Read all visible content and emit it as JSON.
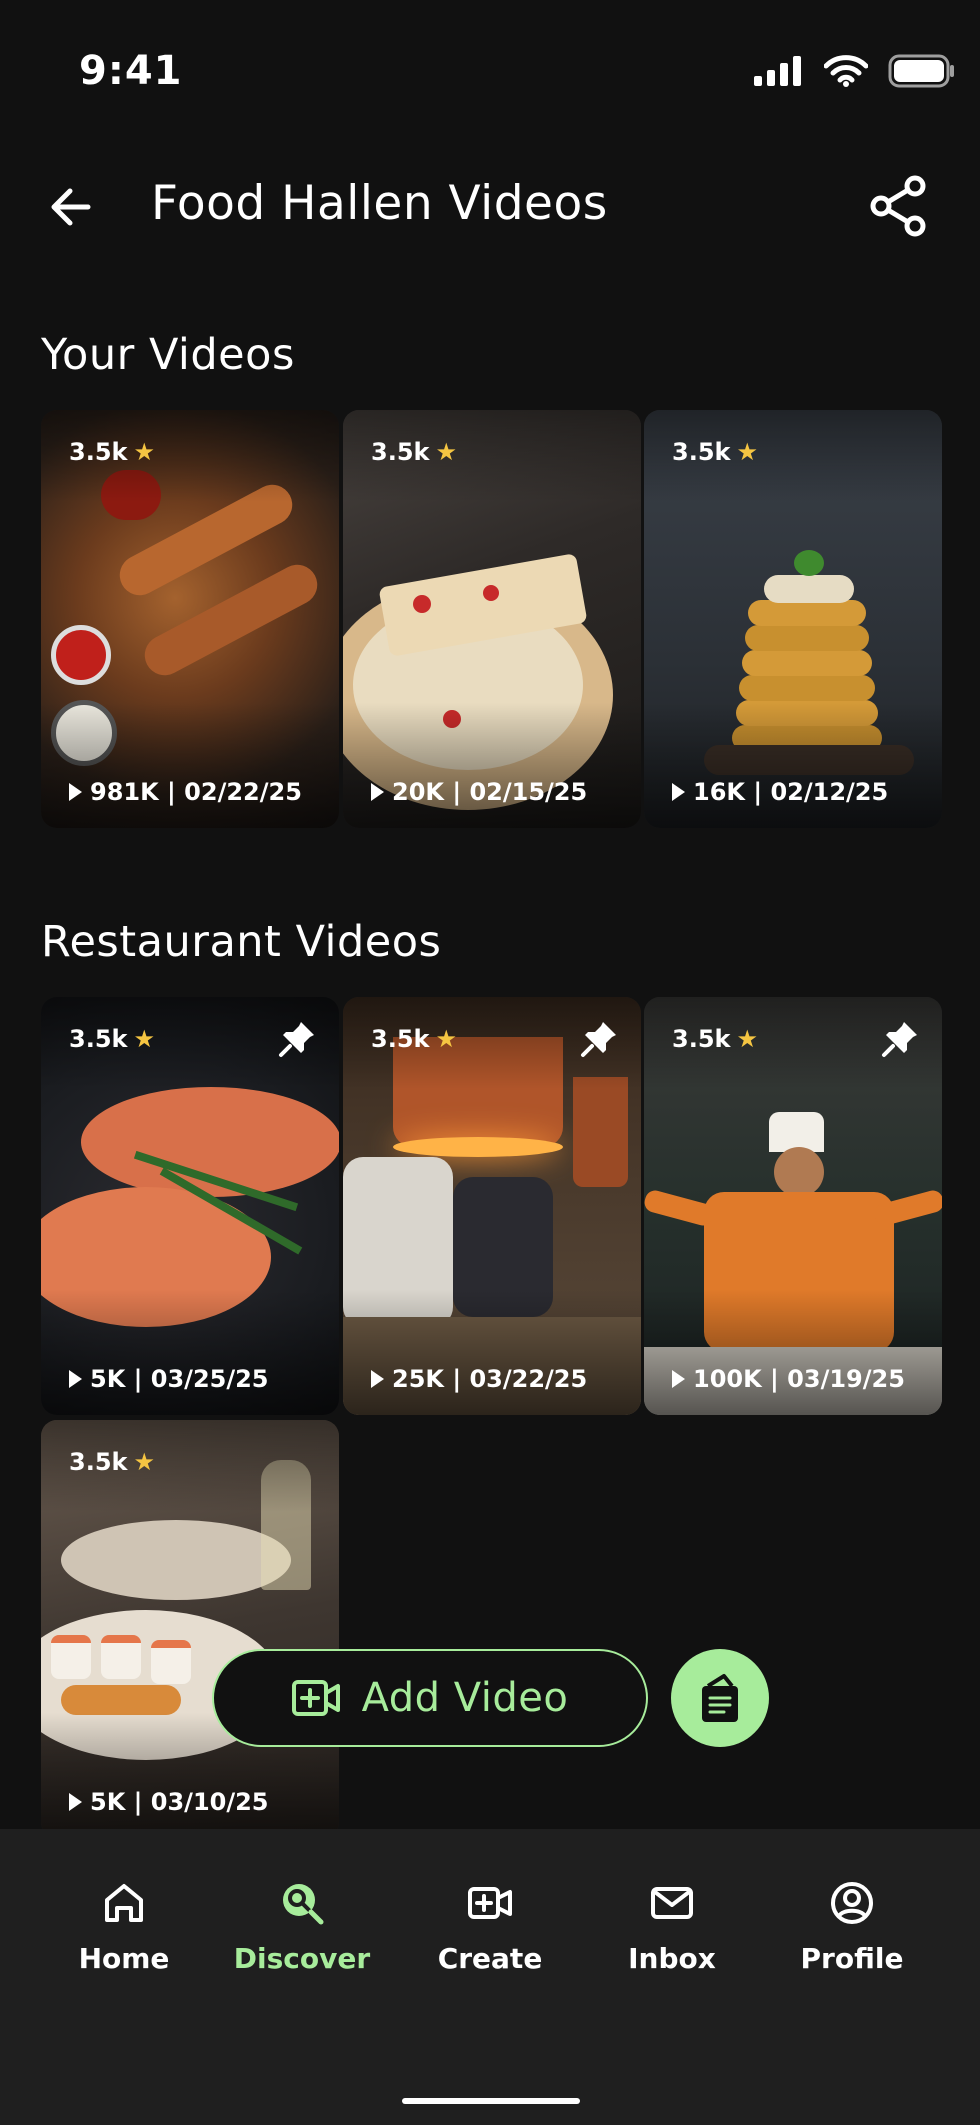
{
  "status_bar": {
    "time": "9:41"
  },
  "header": {
    "title": "Food Hallen Videos"
  },
  "sections": {
    "your_videos": {
      "title": "Your Videos",
      "items": [
        {
          "rating": "3.5k",
          "stats": "981K | 02/22/25",
          "thumb": "grilled-skewers"
        },
        {
          "rating": "3.5k",
          "stats": "20K | 02/15/25",
          "thumb": "pizza-slice"
        },
        {
          "rating": "3.5k",
          "stats": "16K | 02/12/25",
          "thumb": "pancake-stack"
        }
      ]
    },
    "restaurant_videos": {
      "title": "Restaurant Videos",
      "items": [
        {
          "rating": "3.5k",
          "stats": "5K | 03/25/25",
          "thumb": "salmon-steak",
          "pinned": true
        },
        {
          "rating": "3.5k",
          "stats": "25K | 03/22/25",
          "thumb": "kitchen-chefs",
          "pinned": true
        },
        {
          "rating": "3.5k",
          "stats": "100K | 03/19/25",
          "thumb": "chef-portrait",
          "pinned": true
        },
        {
          "rating": "3.5k",
          "stats": "5K | 03/10/25",
          "thumb": "sushi-platter",
          "pinned": false
        }
      ]
    }
  },
  "actions": {
    "add_video_label": "Add Video"
  },
  "bottom_nav": [
    {
      "label": "Home",
      "icon": "home-icon",
      "active": false
    },
    {
      "label": "Discover",
      "icon": "discover-icon",
      "active": true
    },
    {
      "label": "Create",
      "icon": "create-icon",
      "active": false
    },
    {
      "label": "Inbox",
      "icon": "inbox-icon",
      "active": false
    },
    {
      "label": "Profile",
      "icon": "profile-icon",
      "active": false
    }
  ],
  "colors": {
    "accent": "#a7ec9b",
    "background": "#111111",
    "nav_background": "#1f1f1f",
    "star": "#f5c542"
  }
}
